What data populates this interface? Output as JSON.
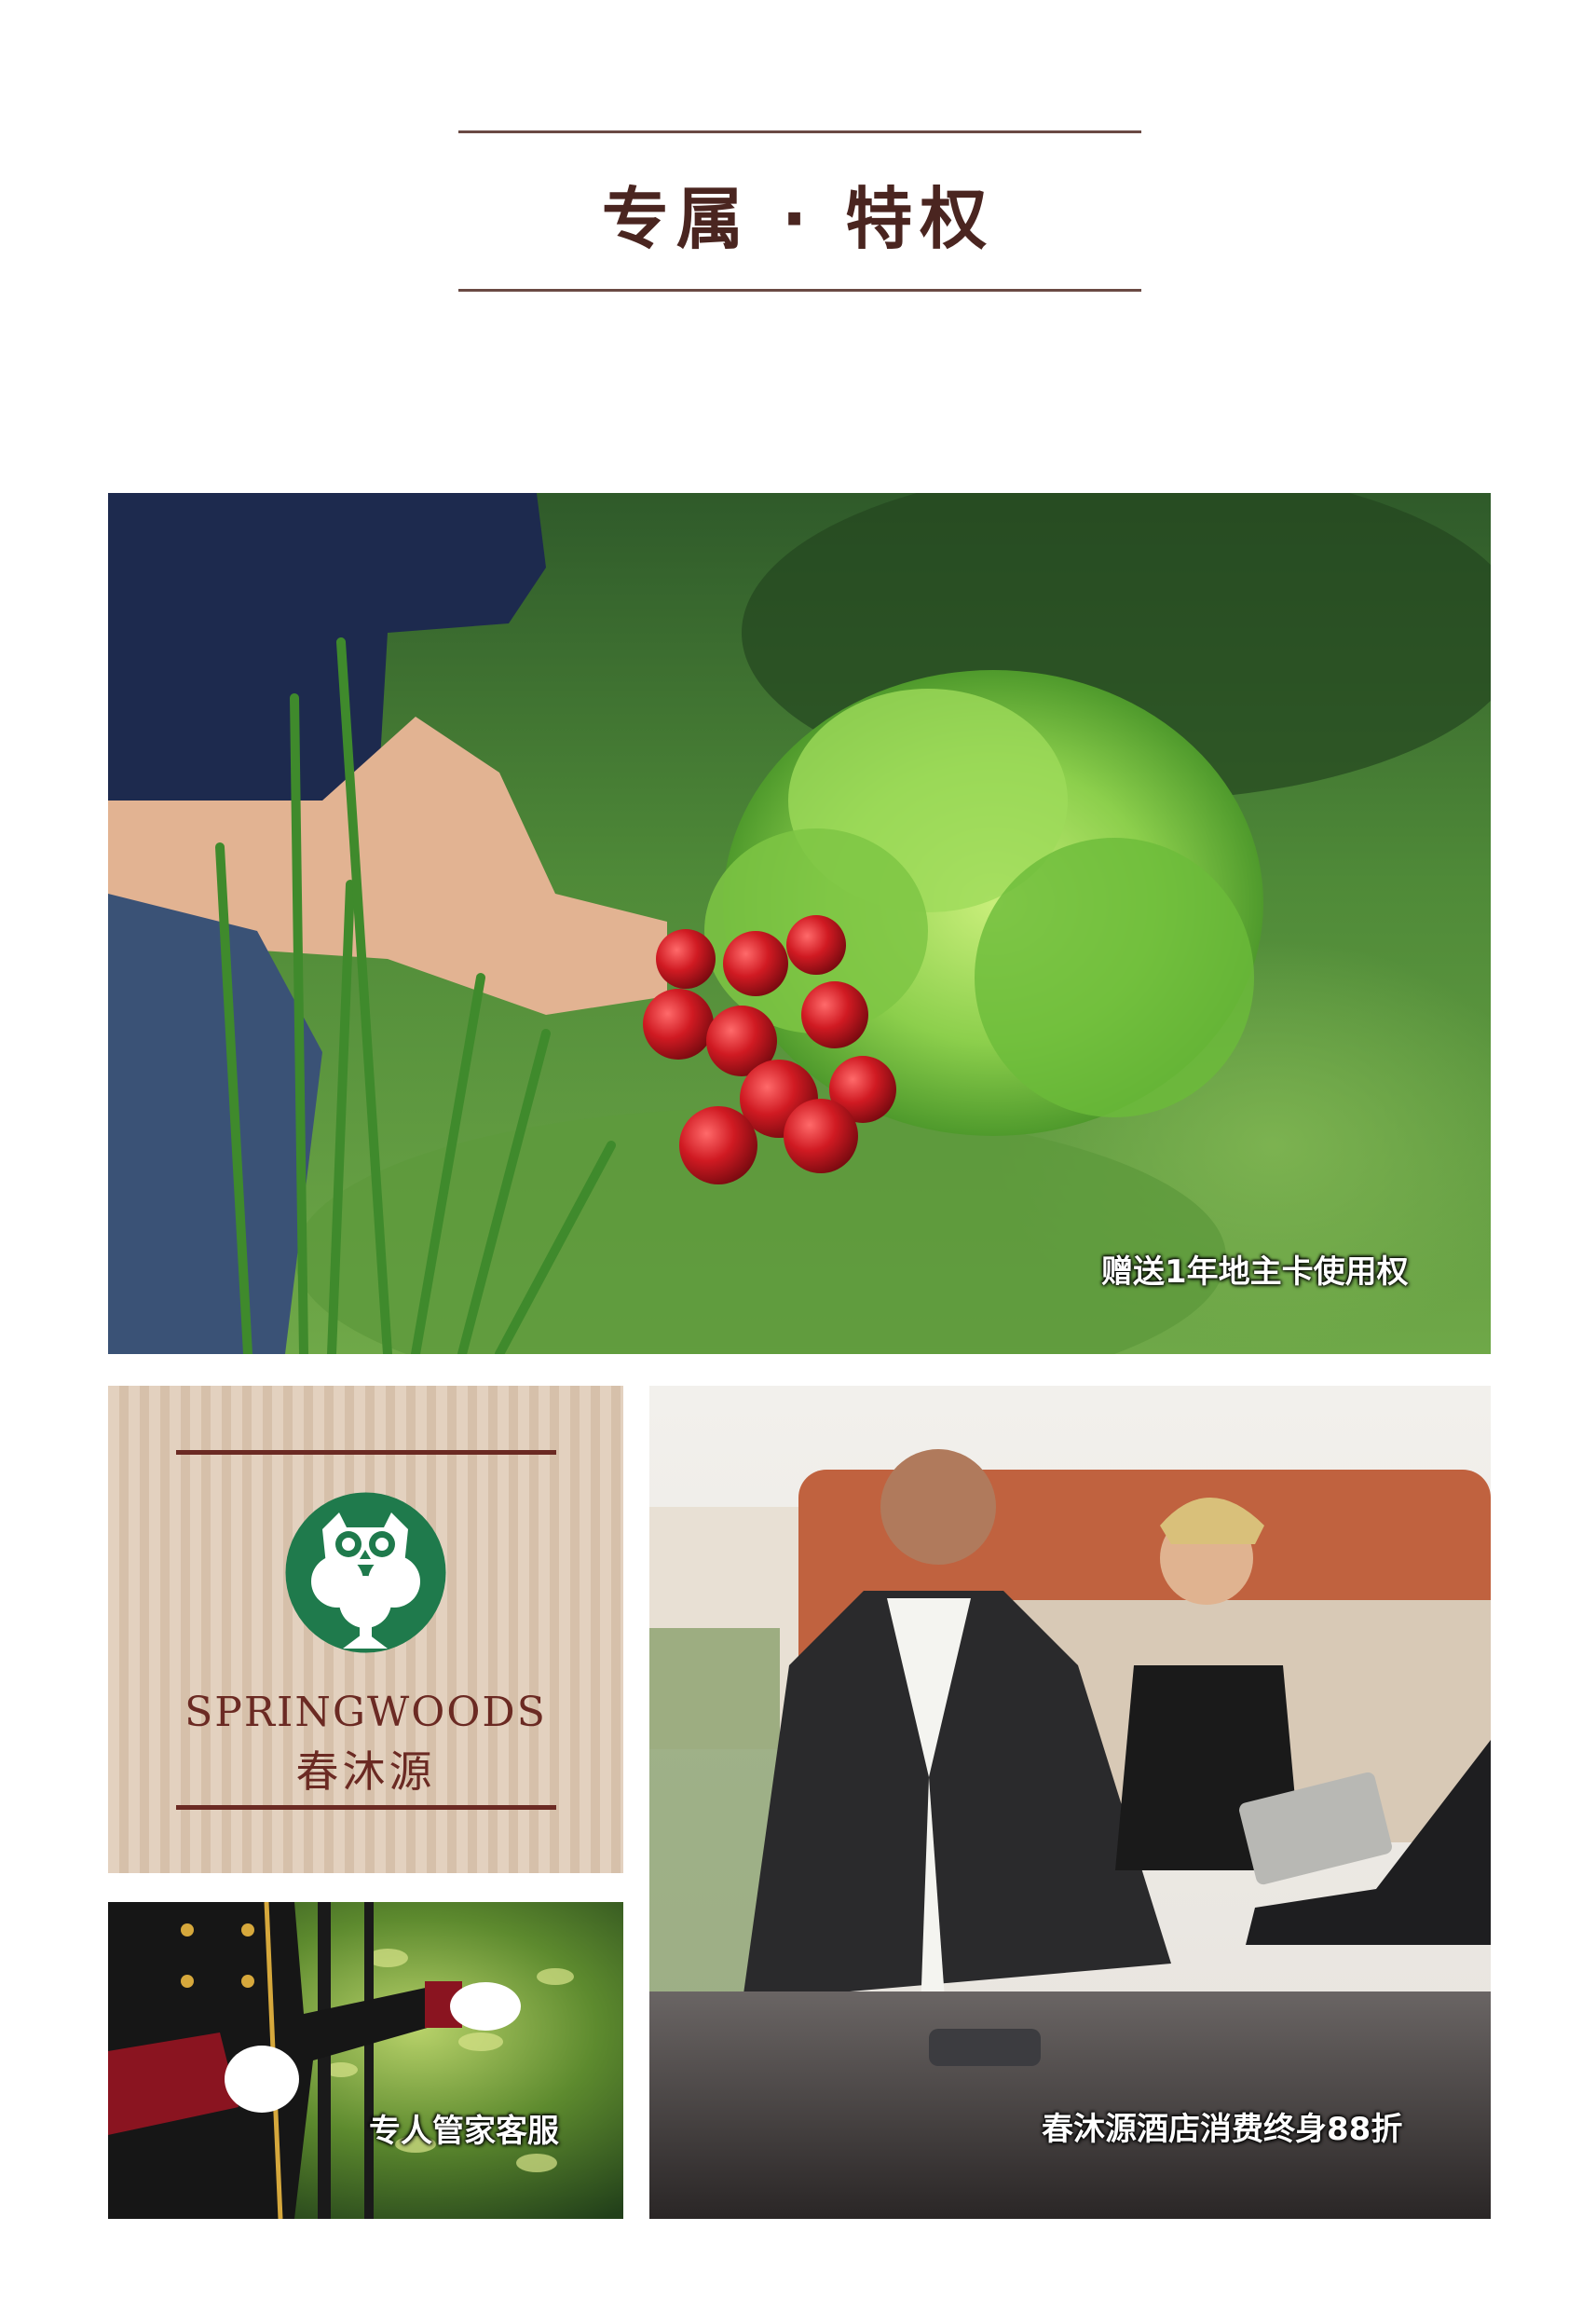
{
  "header": {
    "title": "专属 · 特权"
  },
  "panels": {
    "garden": {
      "caption": "赠送1年地主卡使用权",
      "image_icon": "garden-vegetables-photo"
    },
    "brand": {
      "name_en": "SPRINGWOODS",
      "name_zh": "春沐源",
      "logo_icon": "owl-tree-logo-icon",
      "accent_color": "#6b2a23",
      "logo_color": "#1f7a4c"
    },
    "butler": {
      "caption": "专人管家客服",
      "image_icon": "butler-gloves-photo"
    },
    "hotel": {
      "caption": "春沐源酒店消费终身88折",
      "image_icon": "hotel-reception-photo"
    }
  }
}
